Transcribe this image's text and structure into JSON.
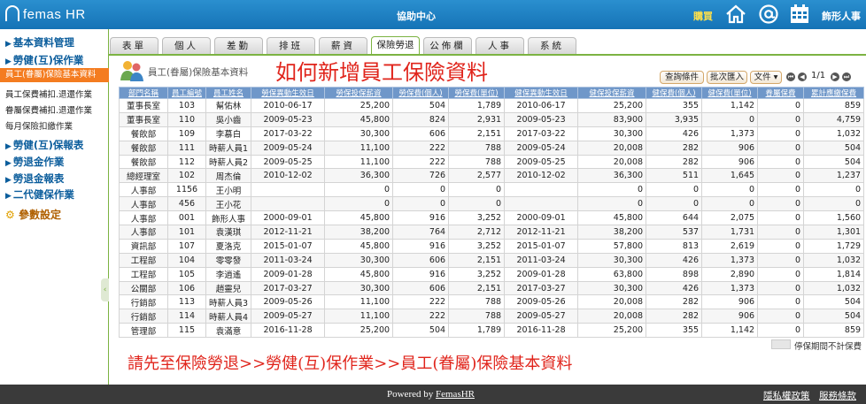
{
  "header": {
    "logo_text": "femas HR",
    "center_title": "協助中心",
    "buy_label": "購買",
    "user_label": "飾形人事"
  },
  "tabs": [
    {
      "label": "表單"
    },
    {
      "label": "個人"
    },
    {
      "label": "差勤"
    },
    {
      "label": "排班"
    },
    {
      "label": "薪資"
    },
    {
      "label": "保險勞退",
      "active": true
    },
    {
      "label": "公佈欄"
    },
    {
      "label": "人事"
    },
    {
      "label": "系統"
    }
  ],
  "sidebar": {
    "items": [
      {
        "label": "基本資料管理",
        "type": "head"
      },
      {
        "label": "勞健(互)保作業",
        "type": "head"
      },
      {
        "label": "員工(眷屬)保險基本資料",
        "type": "sub",
        "active": true
      },
      {
        "label": "員工保費補扣.退還作業",
        "type": "sub"
      },
      {
        "label": "眷屬保費補扣.退還作業",
        "type": "sub"
      },
      {
        "label": "每月保險扣繳作業",
        "type": "sub"
      },
      {
        "label": "勞健(互)保報表",
        "type": "head"
      },
      {
        "label": "勞退金作業",
        "type": "head"
      },
      {
        "label": "勞退金報表",
        "type": "head"
      },
      {
        "label": "二代健保作業",
        "type": "head"
      },
      {
        "label": "參數設定",
        "type": "gear"
      }
    ]
  },
  "page": {
    "title": "員工(眷屬)保險基本資料",
    "overlay_title": "如何新增員工保險資料",
    "buttons": {
      "query": "查詢條件",
      "batch_import": "批次匯入",
      "file": "文件 ▾"
    },
    "page_info": "1/1",
    "legend_text": "停保期間不計保費",
    "instruction": "請先至保險勞退>>勞健(互)保作業>>員工(眷屬)保險基本資料"
  },
  "table": {
    "columns": [
      "部門名稱",
      "員工編號",
      "員工姓名",
      "勞保異動生效日",
      "勞保投保薪資",
      "勞保費(個人)",
      "勞保費(單位)",
      "健保異動生效日",
      "健保投保薪資",
      "健保費(個人)",
      "健保費(單位)",
      "眷屬保費",
      "累計應繳保費"
    ],
    "rows": [
      [
        "董事長室",
        "103",
        "幫佑林",
        "2010-06-17",
        "25,200",
        "504",
        "1,789",
        "2010-06-17",
        "25,200",
        "355",
        "1,142",
        "0",
        "859"
      ],
      [
        "董事長室",
        "110",
        "吳小齒",
        "2009-05-23",
        "45,800",
        "824",
        "2,931",
        "2009-05-23",
        "83,900",
        "3,935",
        "0",
        "0",
        "4,759"
      ],
      [
        "餐飲部",
        "109",
        "李慕白",
        "2017-03-22",
        "30,300",
        "606",
        "2,151",
        "2017-03-22",
        "30,300",
        "426",
        "1,373",
        "0",
        "1,032"
      ],
      [
        "餐飲部",
        "111",
        "時薪人員1",
        "2009-05-24",
        "11,100",
        "222",
        "788",
        "2009-05-24",
        "20,008",
        "282",
        "906",
        "0",
        "504"
      ],
      [
        "餐飲部",
        "112",
        "時薪人員2",
        "2009-05-25",
        "11,100",
        "222",
        "788",
        "2009-05-25",
        "20,008",
        "282",
        "906",
        "0",
        "504"
      ],
      [
        "總經理室",
        "102",
        "周杰倫",
        "2010-12-02",
        "36,300",
        "726",
        "2,577",
        "2010-12-02",
        "36,300",
        "511",
        "1,645",
        "0",
        "1,237"
      ],
      [
        "人事部",
        "1156",
        "王小明",
        "",
        "0",
        "0",
        "0",
        "",
        "0",
        "0",
        "0",
        "0",
        "0"
      ],
      [
        "人事部",
        "456",
        "王小花",
        "",
        "0",
        "0",
        "0",
        "",
        "0",
        "0",
        "0",
        "0",
        "0"
      ],
      [
        "人事部",
        "001",
        "飾形人事",
        "2000-09-01",
        "45,800",
        "916",
        "3,252",
        "2000-09-01",
        "45,800",
        "644",
        "2,075",
        "0",
        "1,560"
      ],
      [
        "人事部",
        "101",
        "袁漢琪",
        "2012-11-21",
        "38,200",
        "764",
        "2,712",
        "2012-11-21",
        "38,200",
        "537",
        "1,731",
        "0",
        "1,301"
      ],
      [
        "資訊部",
        "107",
        "夏洛克",
        "2015-01-07",
        "45,800",
        "916",
        "3,252",
        "2015-01-07",
        "57,800",
        "813",
        "2,619",
        "0",
        "1,729"
      ],
      [
        "工程部",
        "104",
        "零零發",
        "2011-03-24",
        "30,300",
        "606",
        "2,151",
        "2011-03-24",
        "30,300",
        "426",
        "1,373",
        "0",
        "1,032"
      ],
      [
        "工程部",
        "105",
        "李逍遙",
        "2009-01-28",
        "45,800",
        "916",
        "3,252",
        "2009-01-28",
        "63,800",
        "898",
        "2,890",
        "0",
        "1,814"
      ],
      [
        "公關部",
        "106",
        "趙靈兒",
        "2017-03-27",
        "30,300",
        "606",
        "2,151",
        "2017-03-27",
        "30,300",
        "426",
        "1,373",
        "0",
        "1,032"
      ],
      [
        "行銷部",
        "113",
        "時薪人員3",
        "2009-05-26",
        "11,100",
        "222",
        "788",
        "2009-05-26",
        "20,008",
        "282",
        "906",
        "0",
        "504"
      ],
      [
        "行銷部",
        "114",
        "時薪人員4",
        "2009-05-27",
        "11,100",
        "222",
        "788",
        "2009-05-27",
        "20,008",
        "282",
        "906",
        "0",
        "504"
      ],
      [
        "管理部",
        "115",
        "袁滿意",
        "2016-11-28",
        "25,200",
        "504",
        "1,789",
        "2016-11-28",
        "25,200",
        "355",
        "1,142",
        "0",
        "859"
      ]
    ]
  },
  "footer": {
    "powered_prefix": "Powered by ",
    "powered_link": "FemasHR",
    "privacy": "隱私權政策",
    "terms": "服務條款"
  }
}
